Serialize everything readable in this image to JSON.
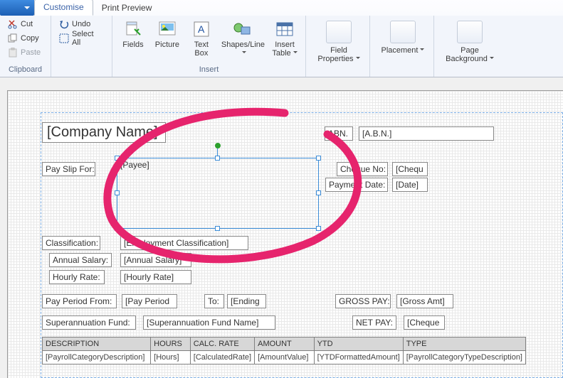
{
  "tabs": {
    "customise": "Customise",
    "preview": "Print Preview"
  },
  "clipboard": {
    "cut": "Cut",
    "copy": "Copy",
    "paste": "Paste",
    "group": "Clipboard"
  },
  "undo_group": {
    "undo": "Undo",
    "selectall": "Select All"
  },
  "insert": {
    "fields": "Fields",
    "picture": "Picture",
    "textbox": "Text\nBox",
    "shapes": "Shapes/Line",
    "table": "Insert\nTable",
    "group": "Insert"
  },
  "props": {
    "fieldprops": "Field\nProperties",
    "placement": "Placement",
    "pagebg": "Page\nBackground"
  },
  "design": {
    "company": "[Company Name]",
    "abn_l": "ABN.",
    "abn_v": "[A.B.N.]",
    "payslip_l": "Pay Slip For:",
    "payee": "[Payee]",
    "cheque_l": "Cheque No:",
    "cheque_v": "[Chequ",
    "paydate_l": "Payment Date:",
    "paydate_v": "[Date]",
    "class_l": "Classification:",
    "class_v": "[Employment Classification]",
    "annual_l": "Annual Salary:",
    "annual_v": "[Annual Salary]",
    "hourly_l": "Hourly Rate:",
    "hourly_v": "[Hourly Rate]",
    "period_l": "Pay Period From:",
    "period_v": "[Pay Period",
    "to_l": "To:",
    "to_v": "[Ending",
    "gross_l": "GROSS PAY:",
    "gross_v": "[Gross Amt]",
    "super_l": "Superannuation Fund:",
    "super_v": "[Superannuation Fund Name]",
    "net_l": "NET PAY:",
    "net_v": "[Cheque"
  },
  "table": {
    "h": [
      "DESCRIPTION",
      "HOURS",
      "CALC. RATE",
      "AMOUNT",
      "YTD",
      "TYPE"
    ],
    "r": [
      "[PayrollCategoryDescription]",
      "[Hours]",
      "[CalculatedRate]",
      "[AmountValue]",
      "[YTDFormattedAmount]",
      "[PayrollCategoryTypeDescription]"
    ]
  }
}
